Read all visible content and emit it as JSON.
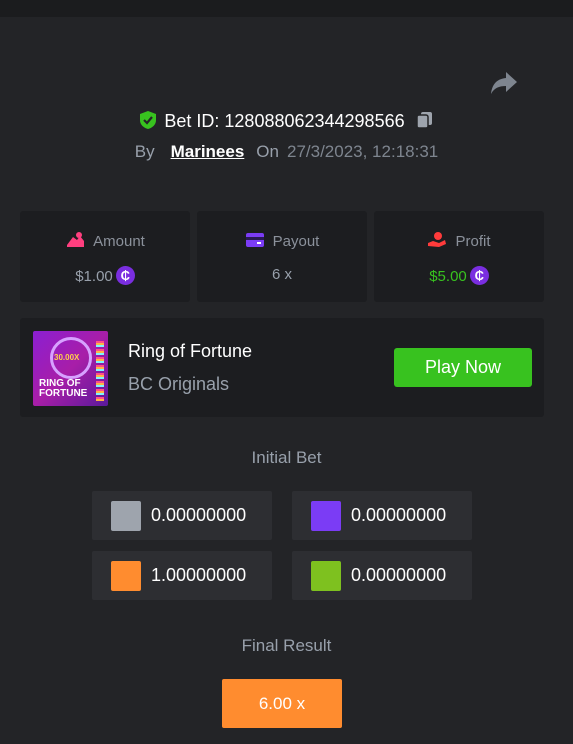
{
  "header": {
    "bet_id_label": "Bet ID: 128088062344298566",
    "by_label": "By",
    "username": "Marinees",
    "on_label": "On",
    "date": "27/3/2023, 12:18:31"
  },
  "stats": [
    {
      "label": "Amount",
      "value": "$1.00",
      "value_color": "#98a0ab",
      "icon": "money-bag-icon",
      "icon_color": "#ff3f7f"
    },
    {
      "label": "Payout",
      "value": "6 x",
      "value_color": "#98a0ab",
      "icon": "card-icon",
      "icon_color": "#7b3cf5"
    },
    {
      "label": "Profit",
      "value": "$5.00",
      "value_color": "#38c21f",
      "icon": "hand-coin-icon",
      "icon_color": "#ff3b3b"
    }
  ],
  "game": {
    "title": "Ring of Fortune",
    "provider": "BC Originals",
    "play_label": "Play Now",
    "thumb_multiplier": "30.00X",
    "thumb_title_line1": "RING OF",
    "thumb_title_line2": "FORTUNE"
  },
  "initial_bet": {
    "title": "Initial Bet",
    "items": [
      {
        "color": "#9ea4ad",
        "value": "0.00000000"
      },
      {
        "color": "#7b3cf5",
        "value": "0.00000000"
      },
      {
        "color": "#ff8c2f",
        "value": "1.00000000"
      },
      {
        "color": "#7ec11f",
        "value": "0.00000000"
      }
    ]
  },
  "final_result": {
    "title": "Final Result",
    "value": "6.00 x",
    "color": "#ff8c2f"
  }
}
